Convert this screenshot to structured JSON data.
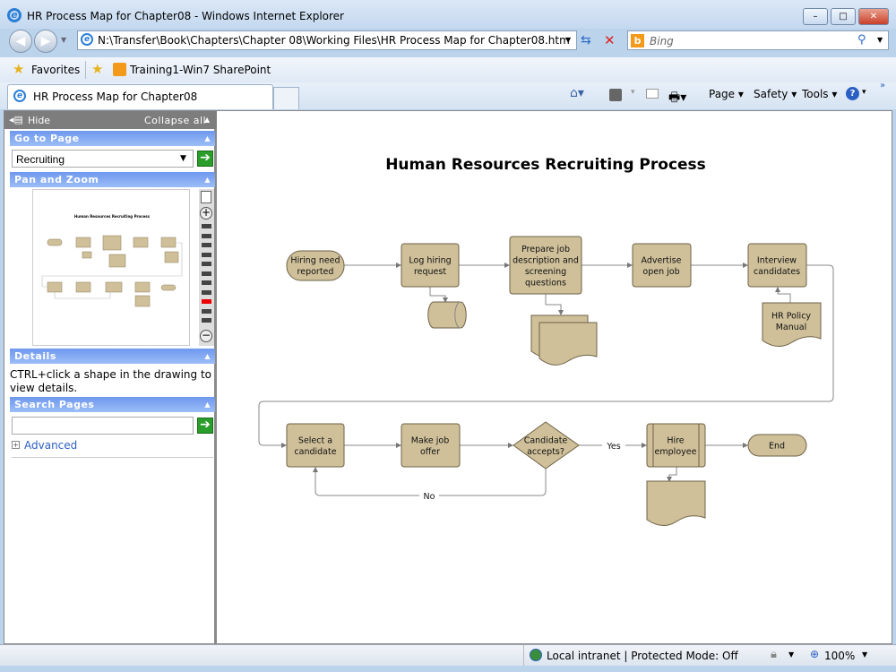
{
  "window": {
    "title": "HR Process Map for Chapter08 - Windows Internet Explorer",
    "minimize": "–",
    "maximize": "□",
    "close": "✕"
  },
  "nav": {
    "address": "N:\\Transfer\\Book\\Chapters\\Chapter 08\\Working Files\\HR Process Map for Chapter08.htm",
    "search_placeholder": "Bing"
  },
  "favorites": {
    "label": "Favorites",
    "items": [
      {
        "label": "Training1-Win7 SharePoint"
      }
    ]
  },
  "tabs": [
    {
      "label": "HR Process Map for Chapter08"
    }
  ],
  "commandbar": {
    "page": "Page",
    "safety": "Safety",
    "tools": "Tools"
  },
  "sidebar": {
    "hide": "Hide",
    "collapse_all": "Collapse all",
    "go_to_page": {
      "title": "Go to Page",
      "selected": "Recruiting"
    },
    "pan_zoom": {
      "title": "Pan and Zoom",
      "thumbnail_title": "Human Resources Recruiting Process",
      "zoom_level_index": 9,
      "zoom_levels": 11
    },
    "details": {
      "title": "Details",
      "text": "CTRL+click a shape in the drawing to view details."
    },
    "search": {
      "title": "Search Pages",
      "value": "",
      "advanced": "Advanced"
    }
  },
  "diagram": {
    "title": "Human Resources Recruiting Process",
    "nodes": {
      "hiring": [
        "Hiring need",
        "reported"
      ],
      "log": [
        "Log hiring",
        "request"
      ],
      "prepare": [
        "Prepare job",
        "description and",
        "screening",
        "questions"
      ],
      "advertise": [
        "Advertise",
        "open job"
      ],
      "interview": [
        "Interview",
        "candidates"
      ],
      "policy": [
        "HR Policy",
        "Manual"
      ],
      "select": [
        "Select a",
        "candidate"
      ],
      "offer": [
        "Make job",
        "offer"
      ],
      "accepts": [
        "Candidate",
        "accepts?"
      ],
      "hire": [
        "Hire",
        "employee"
      ],
      "end": [
        "End"
      ]
    },
    "edge_labels": {
      "yes": "Yes",
      "no": "No"
    }
  },
  "status": {
    "zone": "Local intranet | Protected Mode: Off",
    "zoom": "100%"
  }
}
